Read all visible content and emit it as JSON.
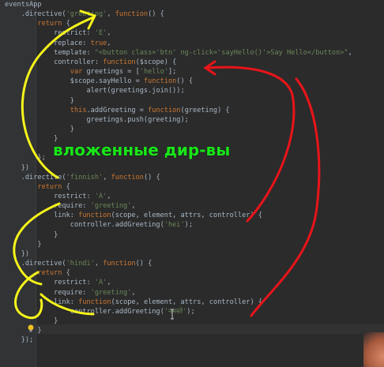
{
  "editor": {
    "lines": [
      "eventsApp",
      "    .directive('greeting', function() {",
      "        return {",
      "            restrict: 'E',",
      "            replace: true,",
      "            template: \"<button class='btn' ng-click='sayHello()'>Say Hello</button>\",",
      "            controller: function($scope) {",
      "                var greetings = ['hello'];",
      "                $scope.sayHello = function() {",
      "                    alert(greetings.join());",
      "                }",
      "                this.addGreeting = function(greeting) {",
      "                    greetings.push(greeting);",
      "                }",
      "            }",
      "",
      "        };",
      "    })",
      "    .directive('finnish', function() {",
      "        return {",
      "            restrict: 'A',",
      "            require: 'greeting',",
      "            link: function(scope, element, attrs, controller) {",
      "                controller.addGreeting('hei');",
      "            }",
      "        }",
      "    })",
      "    .directive('hindi', function() {",
      "        return {",
      "            restrict: 'A',",
      "            require: 'greeting',",
      "            link: function(scope, element, attrs, controller) {",
      "                controller.addGreeting('नमस्ते');",
      "            }",
      "        }",
      "    });"
    ]
  },
  "annotation": {
    "caption": "вложенные дир-вы",
    "yellow_color": "#f5f51a",
    "red_color": "#e8141a",
    "caption_color": "#19e619"
  },
  "colors": {
    "background": "#2b2b2b",
    "keyword": "#cc7832",
    "string": "#6a8759",
    "text": "#a9b7c6"
  },
  "icons": [
    "lightbulb-icon",
    "text-cursor-icon"
  ]
}
